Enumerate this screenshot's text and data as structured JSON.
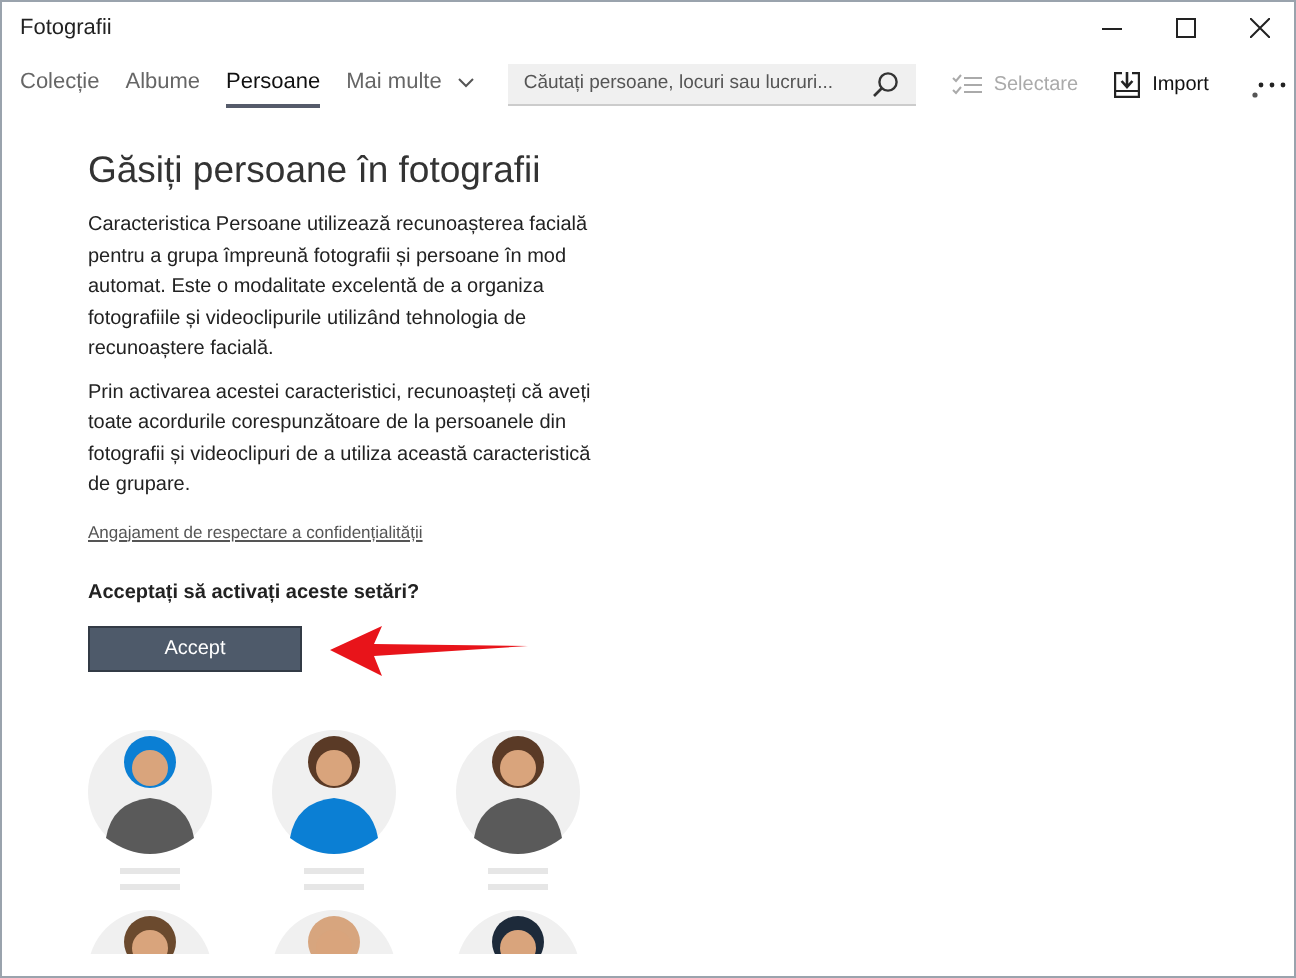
{
  "window": {
    "title": "Fotografii"
  },
  "tabs": [
    {
      "label": "Colecție",
      "selected": false
    },
    {
      "label": "Albume",
      "selected": false
    },
    {
      "label": "Persoane",
      "selected": true
    },
    {
      "label": "Mai multe",
      "selected": false
    }
  ],
  "search": {
    "placeholder": "Căutați persoane, locuri sau lucruri..."
  },
  "toolbar": [
    {
      "label": "Selectare",
      "disabled": true
    },
    {
      "label": "Import",
      "disabled": false
    }
  ],
  "content": {
    "heading": "Găsiți persoane în fotografii",
    "paragraphs": [
      "Caracteristica Persoane utilizează recunoașterea facială pentru a grupa împreună fotografii și persoane în mod automat. Este o modalitate excelentă de a organiza fotografiile și videoclipurile utilizând tehnologia de recunoaștere facială.",
      "Prin activarea acestei caracteristici, recunoașteți că aveți toate acordurile corespunzătoare de la persoanele din fotografii și videoclipuri de a utiliza această caracteristică de grupare."
    ],
    "link": "Angajament de respectare a confidențialității",
    "question": "Acceptați să activați aceste setări?",
    "button": "Accept"
  }
}
